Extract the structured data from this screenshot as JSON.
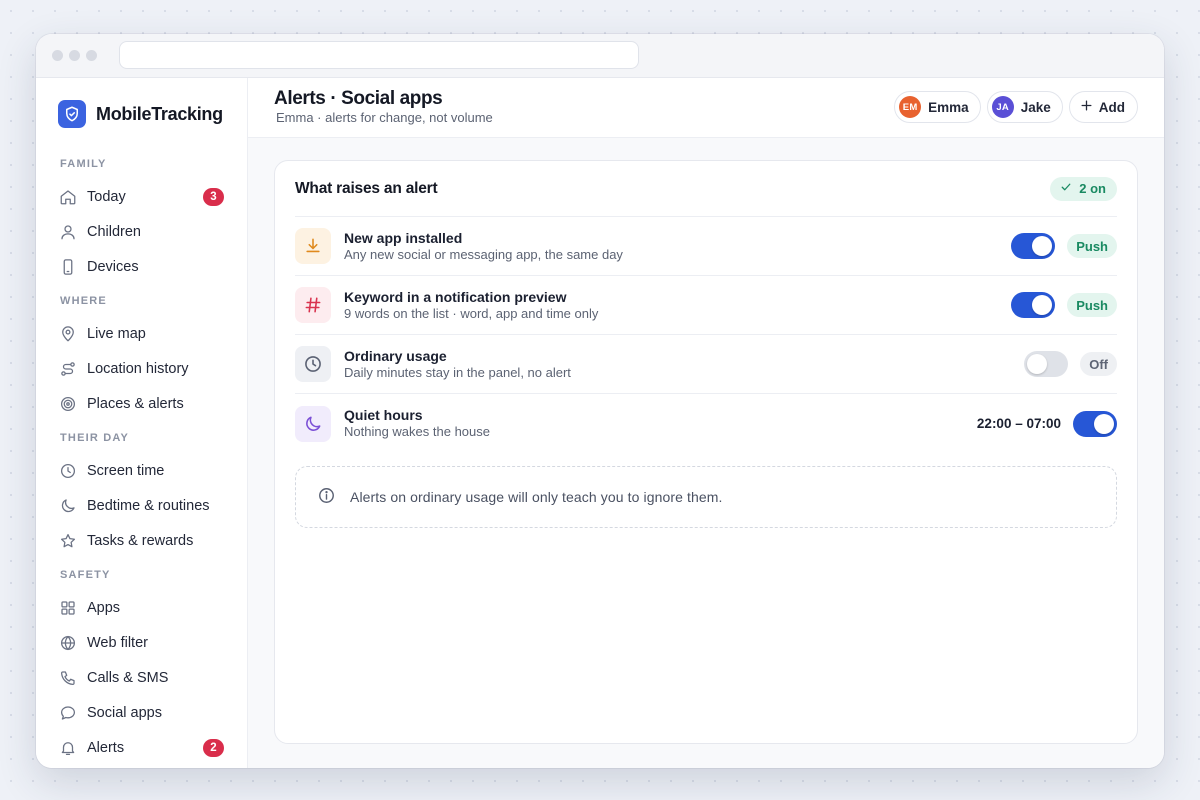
{
  "app": {
    "name": "MobileTracking"
  },
  "sidebar": {
    "sections": [
      {
        "label": "FAMILY",
        "items": [
          {
            "label": "Today",
            "icon": "home-icon",
            "badge": "3"
          },
          {
            "label": "Children",
            "icon": "user-icon"
          },
          {
            "label": "Devices",
            "icon": "phone-icon"
          }
        ]
      },
      {
        "label": "WHERE",
        "items": [
          {
            "label": "Live map",
            "icon": "map-pin-icon"
          },
          {
            "label": "Location history",
            "icon": "route-icon"
          },
          {
            "label": "Places & alerts",
            "icon": "target-icon"
          }
        ]
      },
      {
        "label": "THEIR DAY",
        "items": [
          {
            "label": "Screen time",
            "icon": "clock-icon"
          },
          {
            "label": "Bedtime & routines",
            "icon": "moon-icon"
          },
          {
            "label": "Tasks & rewards",
            "icon": "star-icon"
          }
        ]
      },
      {
        "label": "SAFETY",
        "items": [
          {
            "label": "Apps",
            "icon": "grid-icon"
          },
          {
            "label": "Web filter",
            "icon": "globe-icon"
          },
          {
            "label": "Calls & SMS",
            "icon": "phone-call-icon"
          },
          {
            "label": "Social apps",
            "icon": "chat-bubble-icon"
          },
          {
            "label": "Alerts",
            "icon": "bell-icon",
            "badge": "2"
          }
        ]
      }
    ]
  },
  "header": {
    "title": "Alerts · Social apps",
    "subtitle": "Emma · alerts for change, not volume",
    "people": [
      {
        "initials": "EM",
        "name": "Emma",
        "color": "#e8622f"
      },
      {
        "initials": "JA",
        "name": "Jake",
        "color": "#5a4fd6"
      }
    ],
    "add_label": "Add"
  },
  "card": {
    "title": "What raises an alert",
    "status": "2 on",
    "rules": [
      {
        "title": "New app installed",
        "desc": "Any new social or messaging app, the same day",
        "icon": "download-icon",
        "enabled": true,
        "tag": "Push"
      },
      {
        "title": "Keyword in a notification preview",
        "desc": "9 words on the list · word, app and time only",
        "icon": "hash-icon",
        "enabled": true,
        "tag": "Push"
      },
      {
        "title": "Ordinary usage",
        "desc": "Daily minutes stay in the panel, no alert",
        "icon": "clock-icon",
        "enabled": false,
        "tag": "Off"
      },
      {
        "title": "Quiet hours",
        "desc": "Nothing wakes the house",
        "icon": "moon-icon",
        "enabled": true,
        "time": "22:00 – 07:00"
      }
    ],
    "note": "Alerts on ordinary usage will only teach you to ignore them."
  },
  "colors": {
    "accent": "#2757d6",
    "badge": "#d92d4b",
    "success": "#1a8a62"
  }
}
